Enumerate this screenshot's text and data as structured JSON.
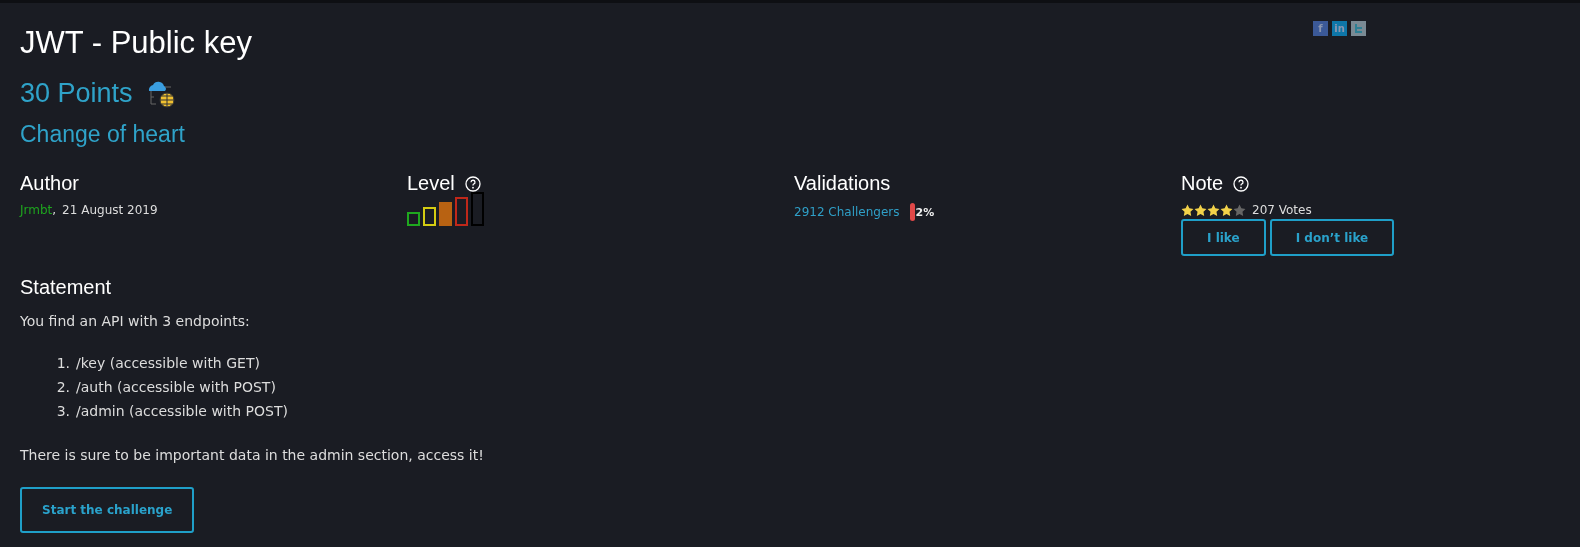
{
  "title": "JWT - Public key",
  "points": "30 Points",
  "subtitle": "Change of heart",
  "social": [
    {
      "kind": "text",
      "text": "f",
      "color": "#3b5998"
    },
    {
      "kind": "text",
      "text": "in",
      "color": "#0e76a8"
    },
    {
      "kind": "bird",
      "color": "#7a8a94"
    }
  ],
  "author": {
    "heading": "Author",
    "name": "Jrmbt",
    "separator": ",",
    "date": "21 August 2019"
  },
  "level": {
    "heading": "Level",
    "bars": [
      {
        "color": "#1fa81f",
        "selected": false
      },
      {
        "color": "#d4cc12",
        "selected": false
      },
      {
        "color": "#b86212",
        "selected": true
      },
      {
        "color": "#c0281a",
        "selected": false
      },
      {
        "color": "#000000",
        "selected": false
      }
    ]
  },
  "validations": {
    "heading": "Validations",
    "challengers": "2912 Challengers",
    "percent": "2%"
  },
  "note": {
    "heading": "Note",
    "stars": 4,
    "votes": "207 Votes",
    "buttons": [
      "I like",
      "I don’t like"
    ]
  },
  "statement": {
    "heading": "Statement",
    "intro": "You find an API with 3 endpoints:",
    "items": [
      "/key (accessible with GET)",
      "/auth (accessible with POST)",
      "/admin (accessible with POST)"
    ],
    "numbers": [
      "1.",
      "2.",
      "3."
    ],
    "outro": "There is sure to be important data in the admin section, access it!"
  },
  "start_button": "Start the challenge"
}
